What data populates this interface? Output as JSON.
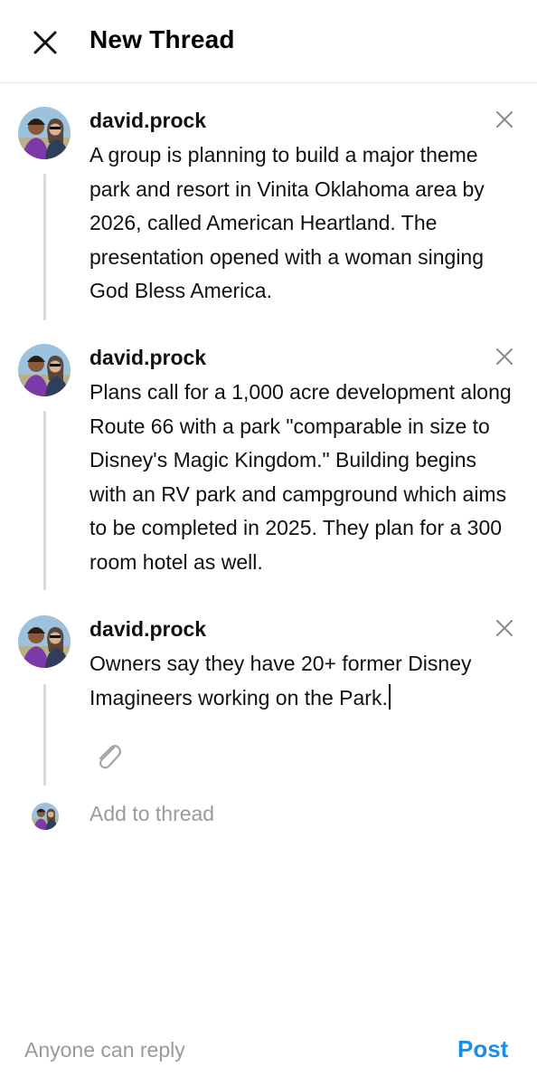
{
  "header": {
    "title": "New Thread",
    "close_icon": "close-icon"
  },
  "posts": [
    {
      "username": "david.prock",
      "text": "A group is planning to build a major theme park and resort in Vinita Oklahoma area by 2026, called American Heartland. The presentation opened with a woman singing God Bless America."
    },
    {
      "username": "david.prock",
      "text": "Plans call for a 1,000 acre development along Route 66 with a park \"comparable in size to Disney's Magic Kingdom.\" Building begins with an RV park and campground which aims to be completed in 2025. They plan for a 300 room hotel as well."
    },
    {
      "username": "david.prock",
      "text": "Owners say they have 20+ former Disney Imagineers working on the Park."
    }
  ],
  "composer": {
    "attach_icon": "paperclip-icon",
    "add_placeholder": "Add to thread"
  },
  "footer": {
    "reply_setting": "Anyone can reply",
    "post_label": "Post",
    "accent_color": "#1a8de8"
  }
}
